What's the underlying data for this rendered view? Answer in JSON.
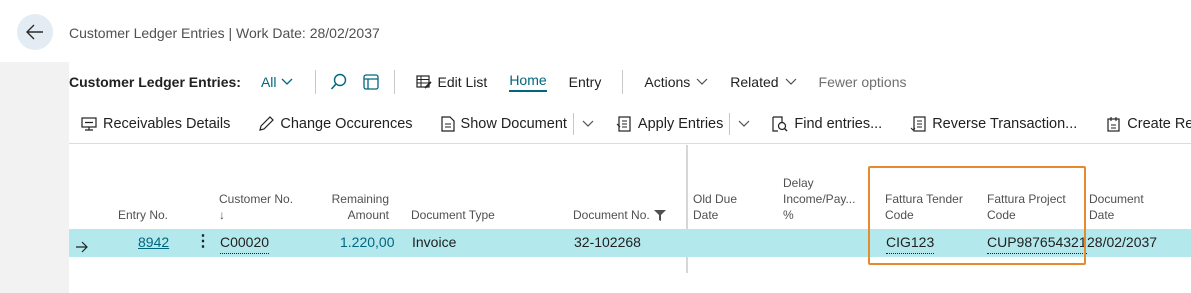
{
  "header": {
    "title": "Customer Ledger Entries | Work Date: 28/02/2037"
  },
  "actionbar": {
    "label": "Customer Ledger Entries:",
    "view": "All",
    "edit_list": "Edit List",
    "home": "Home",
    "entry": "Entry",
    "actions": "Actions",
    "related": "Related",
    "fewer_options": "Fewer options"
  },
  "commands": {
    "receivables_details": "Receivables Details",
    "change_occurences": "Change Occurences",
    "show_document": "Show Document",
    "apply_entries": "Apply Entries",
    "find_entries": "Find entries...",
    "reverse_transaction": "Reverse Transaction...",
    "create_reminder": "Create Reminder..."
  },
  "columns": {
    "entry_no": "Entry No.",
    "customer_no": "Customer No.",
    "customer_no_sort": "↓",
    "remaining_l1": "Remaining",
    "remaining_l2": "Amount",
    "document_type": "Document Type",
    "document_no": "Document No.",
    "old_due_l1": "Old Due",
    "old_due_l2": "Date",
    "delay_l1": "Delay",
    "delay_l2": "Income/Pay...",
    "delay_l3": "%",
    "tender_l1": "Fattura Tender",
    "tender_l2": "Code",
    "project_l1": "Fattura Project",
    "project_l2": "Code",
    "docdate_l1": "Document",
    "docdate_l2": "Date"
  },
  "row": {
    "entry_no": "8942",
    "customer_no": "C00020",
    "remaining_amount": "1.220,00",
    "document_type": "Invoice",
    "document_no": "32-102268",
    "old_due_date": "",
    "delay_pct": "",
    "tender_code": "CIG123",
    "project_code": "CUP987654321",
    "document_date": "28/02/2037"
  },
  "colors": {
    "accent": "#00677f",
    "row_selected": "#b3e9ed",
    "highlight_border": "#e68a2e"
  }
}
